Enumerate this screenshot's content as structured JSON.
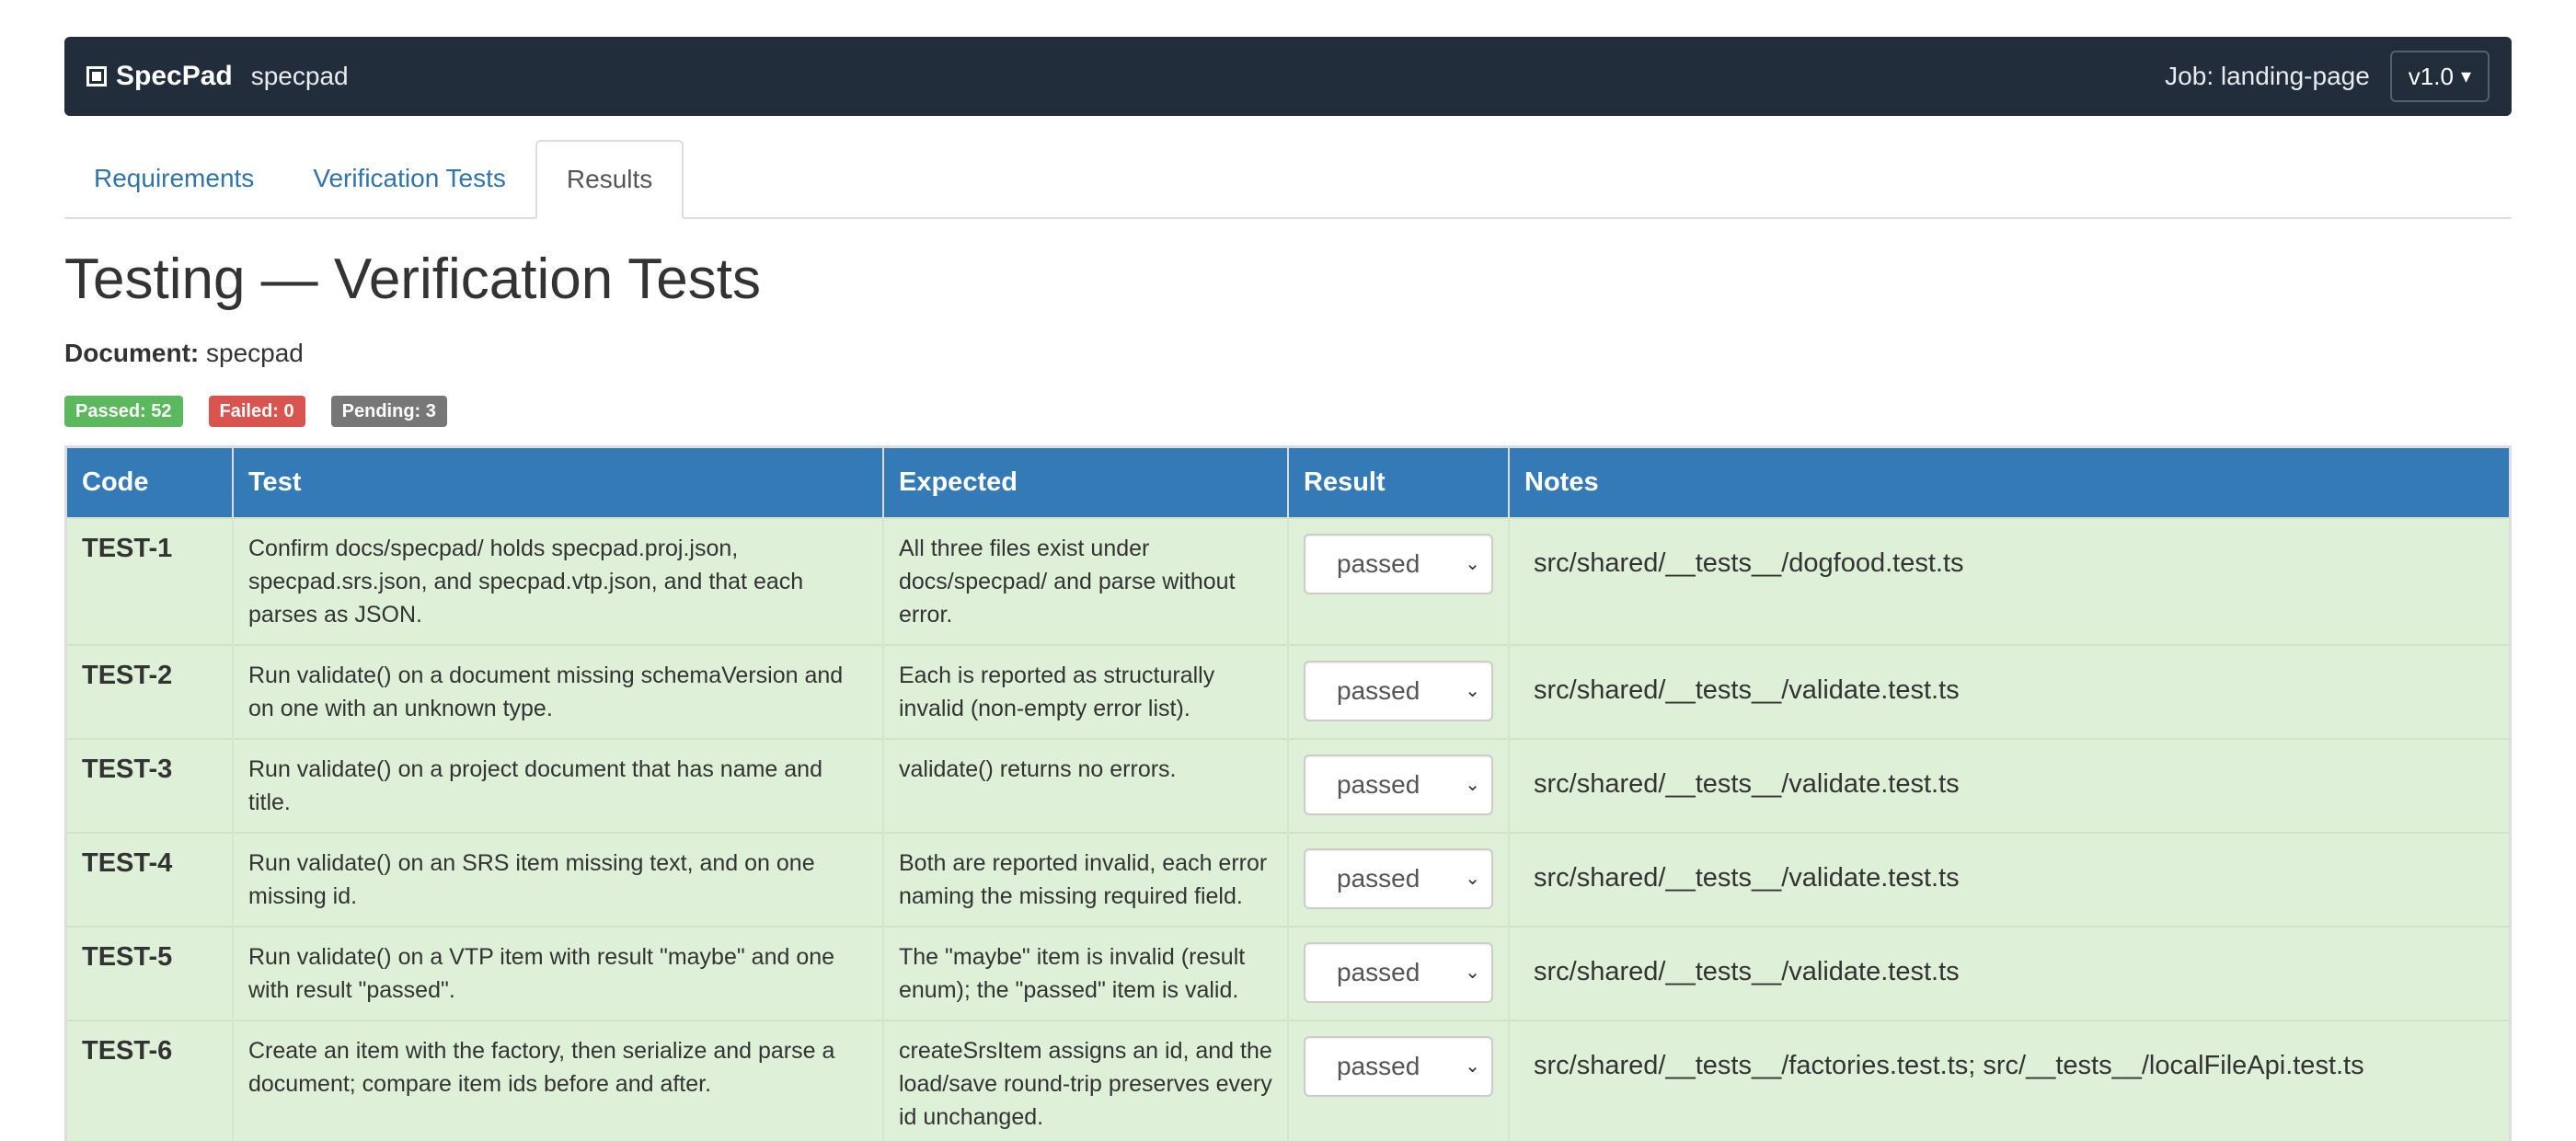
{
  "navbar": {
    "brand": "SpecPad",
    "project": "specpad",
    "job_label": "Job: landing-page",
    "version": "v1.0"
  },
  "tabs": [
    {
      "label": "Requirements",
      "active": false
    },
    {
      "label": "Verification Tests",
      "active": false
    },
    {
      "label": "Results",
      "active": true
    }
  ],
  "page": {
    "title": "Testing — Verification Tests",
    "document_label": "Document:",
    "document_value": "specpad"
  },
  "badges": {
    "passed": "Passed: 52",
    "failed": "Failed: 0",
    "pending": "Pending: 3"
  },
  "colors": {
    "navbar_bg": "#222d3c",
    "table_header_bg": "#337ab7",
    "row_passed_bg": "#dff0d8",
    "badge_passed": "#5cb85c",
    "badge_failed": "#d9534f",
    "badge_pending": "#777777",
    "link": "#2f73b0"
  },
  "table": {
    "headers": [
      "Code",
      "Test",
      "Expected",
      "Result",
      "Notes"
    ],
    "rows": [
      {
        "code": "TEST-1",
        "test": "Confirm docs/specpad/ holds specpad.proj.json, specpad.srs.json, and specpad.vtp.json, and that each parses as JSON.",
        "expected": "All three files exist under docs/specpad/ and parse without error.",
        "result": "passed",
        "notes": "src/shared/__tests__/dogfood.test.ts"
      },
      {
        "code": "TEST-2",
        "test": "Run validate() on a document missing schemaVersion and on one with an unknown type.",
        "expected": "Each is reported as structurally invalid (non-empty error list).",
        "result": "passed",
        "notes": "src/shared/__tests__/validate.test.ts"
      },
      {
        "code": "TEST-3",
        "test": "Run validate() on a project document that has name and title.",
        "expected": "validate() returns no errors.",
        "result": "passed",
        "notes": "src/shared/__tests__/validate.test.ts"
      },
      {
        "code": "TEST-4",
        "test": "Run validate() on an SRS item missing text, and on one missing id.",
        "expected": "Both are reported invalid, each error naming the missing required field.",
        "result": "passed",
        "notes": "src/shared/__tests__/validate.test.ts"
      },
      {
        "code": "TEST-5",
        "test": "Run validate() on a VTP item with result \"maybe\" and one with result \"passed\".",
        "expected": "The \"maybe\" item is invalid (result enum); the \"passed\" item is valid.",
        "result": "passed",
        "notes": "src/shared/__tests__/validate.test.ts"
      },
      {
        "code": "TEST-6",
        "test": "Create an item with the factory, then serialize and parse a document; compare item ids before and after.",
        "expected": "createSrsItem assigns an id, and the load/save round-trip preserves every id unchanged.",
        "result": "passed",
        "notes": "src/shared/__tests__/factories.test.ts; src/__tests__/localFileApi.test.ts"
      }
    ]
  }
}
